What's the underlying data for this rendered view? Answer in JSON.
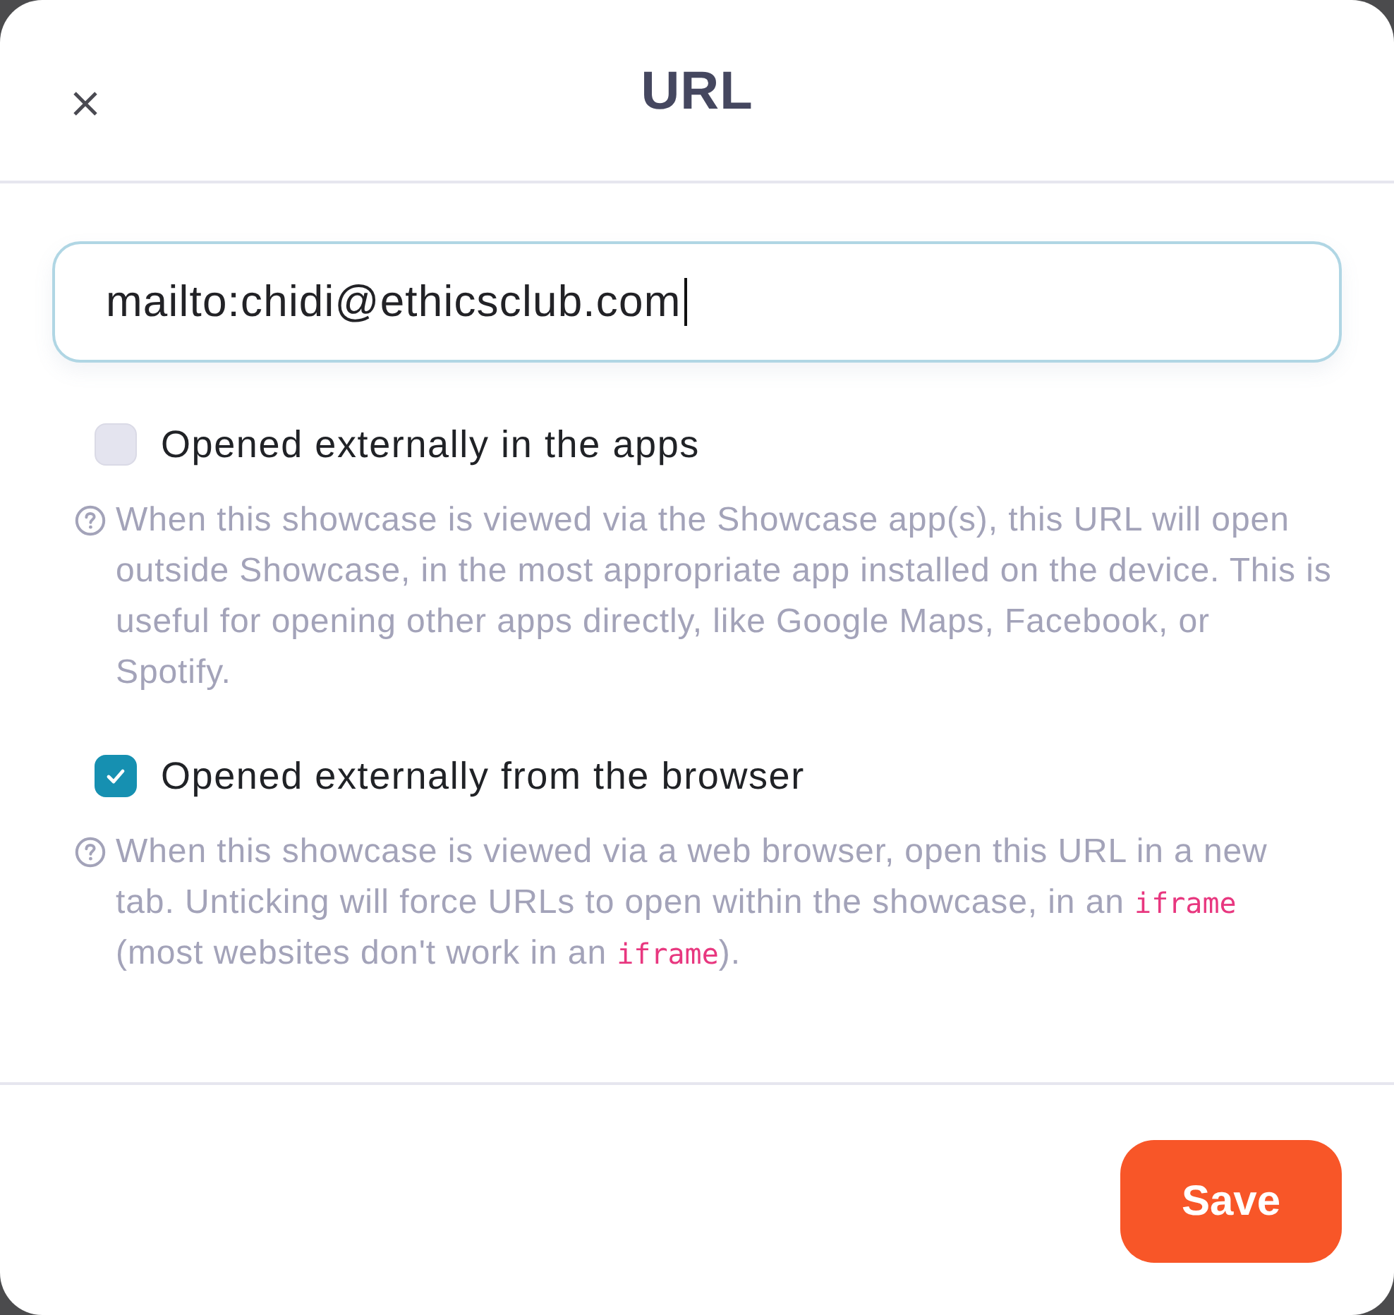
{
  "dialog": {
    "title": "URL"
  },
  "url_field": {
    "value": "mailto:chidi@ethicsclub.com",
    "focused": true
  },
  "options": [
    {
      "label": "Opened externally in the apps",
      "checked": false,
      "help": [
        {
          "kind": "text",
          "text": "When this showcase is viewed via the Showcase app(s), this URL will open outside Showcase, in the most appropriate app installed on the device. This is useful for opening other apps directly, like Google Maps, Facebook, or Spotify."
        }
      ]
    },
    {
      "label": "Opened externally from the browser",
      "checked": true,
      "help": [
        {
          "kind": "text",
          "text": "When this showcase is viewed via a web browser, open this URL in a new tab. Unticking will force URLs to open within the showcase, in an "
        },
        {
          "kind": "code",
          "text": "iframe"
        },
        {
          "kind": "text",
          "text": " (most websites don't work in an "
        },
        {
          "kind": "code",
          "text": "iframe"
        },
        {
          "kind": "text",
          "text": ")."
        }
      ]
    }
  ],
  "buttons": [
    {
      "label": "Save",
      "kind": "primary"
    }
  ]
}
